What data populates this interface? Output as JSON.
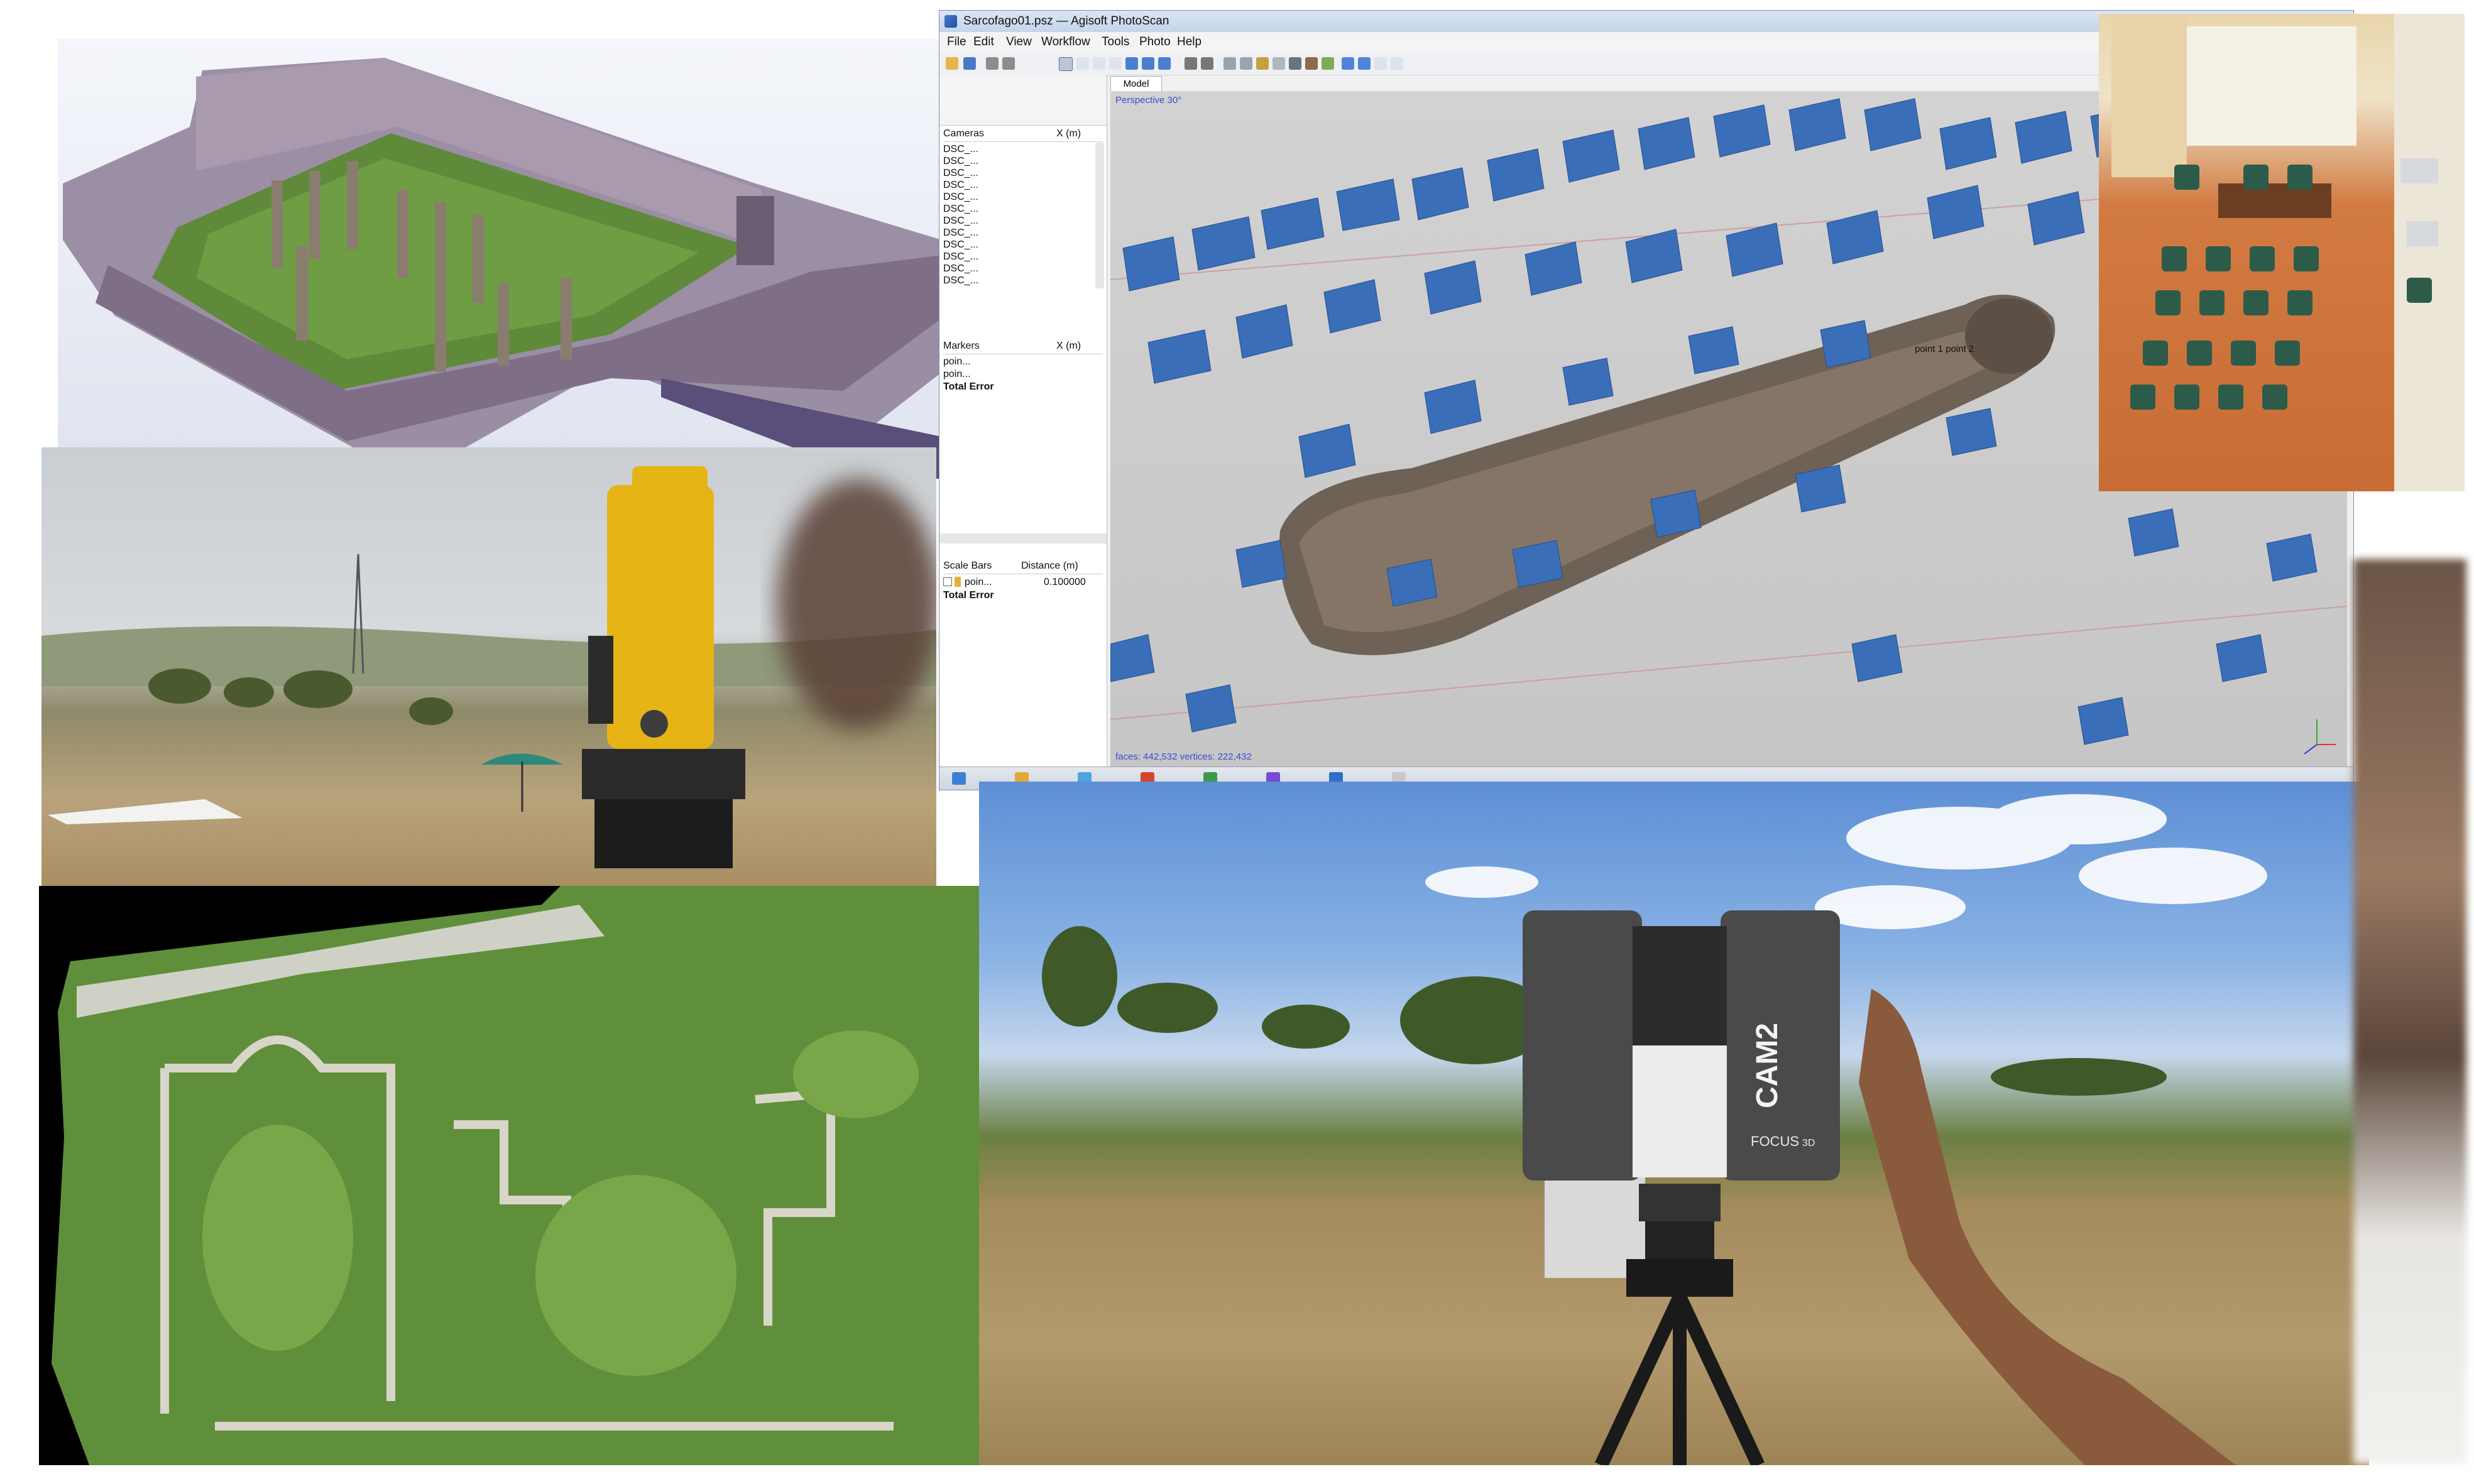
{
  "photoscan": {
    "window_title": "Sarcofago01.psz — Agisoft PhotoScan",
    "menus": [
      "File",
      "Edit",
      "View",
      "Workflow",
      "Tools",
      "Photo",
      "Help"
    ],
    "left_panel": {
      "cameras_header": [
        "Cameras",
        "X (m)"
      ],
      "camera_rows": [
        "DSC_...",
        "DSC_...",
        "DSC_...",
        "DSC_...",
        "DSC_...",
        "DSC_...",
        "DSC_...",
        "DSC_...",
        "DSC_...",
        "DSC_...",
        "DSC_...",
        "DSC_..."
      ],
      "markers_header": [
        "Markers",
        "X (m)"
      ],
      "marker_rows": [
        "poin...",
        "poin..."
      ],
      "markers_total": "Total Error",
      "scalebars_header": [
        "Scale Bars",
        "Distance (m)"
      ],
      "scalebar_row": {
        "name": "poin...",
        "distance": "0.100000"
      },
      "scalebars_total": "Total Error"
    },
    "tab_model": "Model",
    "viewport_label": "Perspective 30°",
    "viewport_stats": "faces: 442,532 vertices: 222,432",
    "markers_on_model": "point 1 point 2"
  },
  "scanner": {
    "brand": "CAM2",
    "model": "FOCUS",
    "model_suffix": "3D"
  },
  "colors": {
    "camera_plane": "#3a6eb8",
    "viewport_text": "#3b4dd3",
    "total_station_yellow": "#e7b416"
  }
}
